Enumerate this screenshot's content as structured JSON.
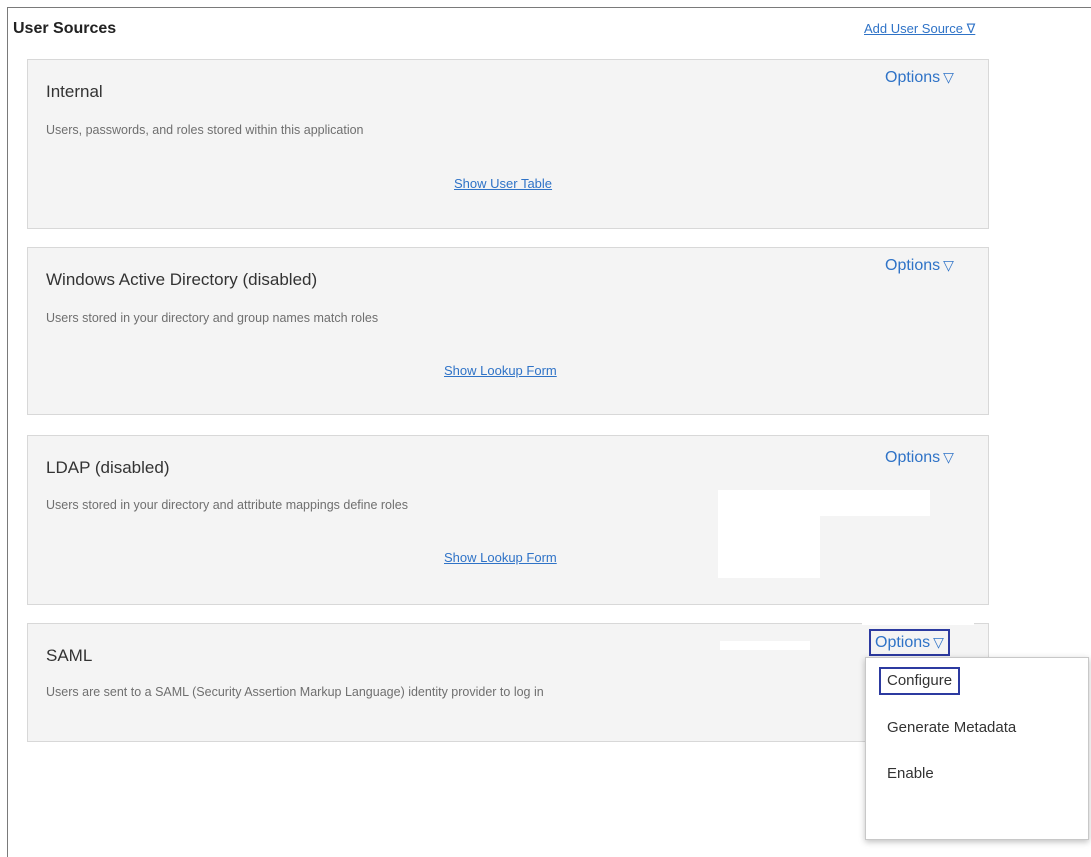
{
  "header": {
    "title": "User Sources",
    "add_link": "Add User Source ∇"
  },
  "sources": [
    {
      "name": "Internal",
      "description": "Users, passwords, and roles stored within this application",
      "options_label": "Options",
      "action_link": "Show User Table"
    },
    {
      "name": "Windows Active Directory (disabled)",
      "description": "Users stored in your directory and group names match roles",
      "options_label": "Options",
      "action_link": "Show Lookup Form"
    },
    {
      "name": "LDAP (disabled)",
      "description": "Users stored in your directory and attribute mappings define roles",
      "options_label": "Options",
      "action_link": "Show Lookup Form"
    },
    {
      "name": "SAML",
      "description": "Users are sent to a SAML (Security Assertion Markup Language) identity provider to log in",
      "options_label": "Options"
    }
  ],
  "options_menu": {
    "items": [
      "Configure",
      "Generate Metadata",
      "Enable"
    ]
  },
  "colors": {
    "link": "#2f73c7",
    "card_bg": "#f4f4f4",
    "highlight": "#2c3aa0"
  }
}
